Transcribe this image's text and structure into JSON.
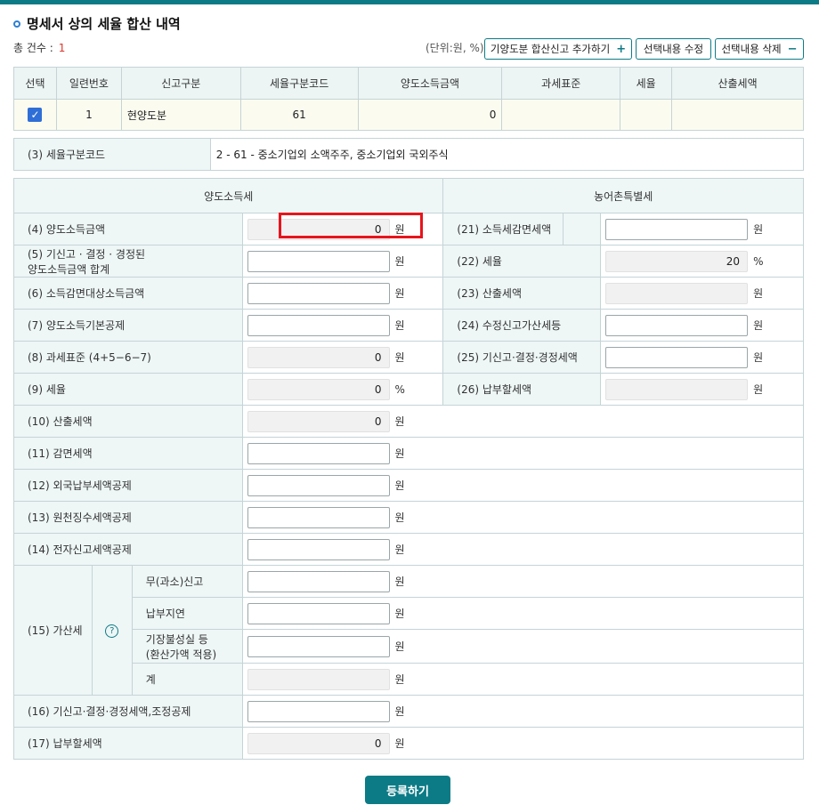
{
  "colors": {
    "accent": "#0d7b86",
    "highlight": "#e8141c",
    "checkbox": "#2f6ed6"
  },
  "title": "명세서 상의 세율 합산 내역",
  "count_label": "총 건수 :",
  "count_value": "1",
  "unit_text": "(단위:원, %)",
  "buttons": {
    "add_label": "기양도분 합산신고 추가하기",
    "add_sym": "+",
    "edit_label": "선택내용 수정",
    "delete_label": "선택내용 삭제",
    "delete_sym": "−",
    "submit_label": "등록하기"
  },
  "grid": {
    "headers": [
      "선택",
      "일련번호",
      "신고구분",
      "세율구분코드",
      "양도소득금액",
      "과세표준",
      "세율",
      "산출세액"
    ],
    "row": {
      "checked": "✓",
      "serial": "1",
      "report_type": "현양도분",
      "rate_code": "61",
      "transfer_income": "0",
      "tax_base": "",
      "tax_rate": "",
      "calculated_tax": ""
    }
  },
  "rate_code_row": {
    "label": "(3) 세율구분코드",
    "value": "2  -  61  -  중소기업외 소액주주, 중소기업외 국외주식"
  },
  "form": {
    "left_header": "양도소득세",
    "right_header": "농어촌특별세",
    "unit_won": "원",
    "unit_pct": "%",
    "left": {
      "r4": {
        "label": "(4) 양도소득금액",
        "value": "0"
      },
      "r5_line1": "(5) 기신고 · 결정 · 경정된",
      "r5_line2": "양도소득금액 합계",
      "r6": "(6) 소득감면대상소득금액",
      "r7": "(7) 양도소득기본공제",
      "r8": {
        "label": "(8) 과세표준 (4+5−6−7)",
        "value": "0"
      },
      "r9": {
        "label": "(9) 세율",
        "value": "0"
      },
      "r10": {
        "label": "(10) 산출세액",
        "value": "0"
      },
      "r11": "(11) 감면세액",
      "r12": "(12) 외국납부세액공제",
      "r13": "(13) 원천징수세액공제",
      "r14": "(14) 전자신고세액공제",
      "r15": {
        "label": "(15) 가산세",
        "help": "?",
        "sub1": "무(과소)신고",
        "sub2": "납부지연",
        "sub3_line1": "기장불성실 등",
        "sub3_line2": "(환산가액 적용)",
        "sub4": "계"
      },
      "r16": "(16) 기신고·결정·경정세액,조정공제",
      "r17": {
        "label": "(17) 납부할세액",
        "value": "0"
      }
    },
    "right": {
      "r21": "(21) 소득세감면세액",
      "r22": {
        "label": "(22) 세율",
        "value": "20"
      },
      "r23": "(23) 산출세액",
      "r24": "(24) 수정신고가산세등",
      "r25": "(25) 기신고·결정·경정세액",
      "r26": "(26) 납부할세액"
    }
  }
}
